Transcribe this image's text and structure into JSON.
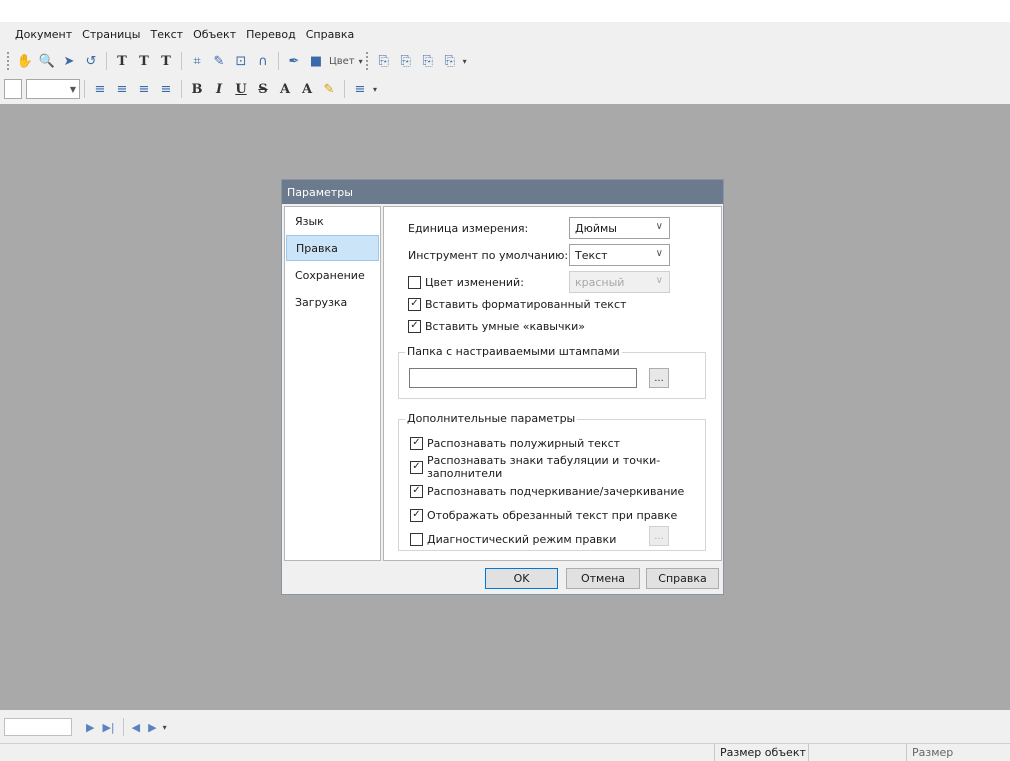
{
  "menu": {
    "items": [
      "Документ",
      "Страницы",
      "Текст",
      "Объект",
      "Перевод",
      "Справка"
    ]
  },
  "toolbar1": {
    "color_label": "Цвет"
  },
  "dialog": {
    "title": "Параметры",
    "nav": [
      "Язык",
      "Правка",
      "Сохранение",
      "Загрузка"
    ],
    "selected_nav": "Правка",
    "unit_label": "Единица измерения:",
    "unit_value": "Дюймы",
    "tool_label": "Инструмент по умолчанию:",
    "tool_value": "Текст",
    "change_color_label": "Цвет изменений:",
    "change_color_value": "красный",
    "change_color_checked": false,
    "paste_formatted_label": "Вставить форматированный текст",
    "paste_formatted_checked": true,
    "smart_quotes_label": "Вставить умные «кавычки»",
    "smart_quotes_checked": true,
    "stamps_group_label": "Папка с настраиваемыми штампами",
    "stamps_path_value": "",
    "browse_label": "...",
    "advanced_group_label": "Дополнительные параметры",
    "advanced": [
      {
        "label": "Распознавать полужирный текст",
        "checked": true
      },
      {
        "label": "Распознавать знаки табуляции и точки-заполнители",
        "checked": true
      },
      {
        "label": "Распознавать подчеркивание/зачеркивание",
        "checked": true
      },
      {
        "label": "Отображать обрезанный текст при правке",
        "checked": true
      },
      {
        "label": "Диагностический режим правки",
        "checked": false
      }
    ],
    "diag_button_label": "...",
    "ok_label": "OK",
    "cancel_label": "Отмена",
    "help_label": "Справка"
  },
  "status": {
    "object_size_label": "Размер объект",
    "page_size_label": "Размер страницы"
  },
  "colors": {
    "dialog_title_bg": "#6b7a8d",
    "workspace_bg": "#a9a9a9",
    "nav_selected_bg": "#cce4f7",
    "primary_button_border": "#0078d7"
  }
}
